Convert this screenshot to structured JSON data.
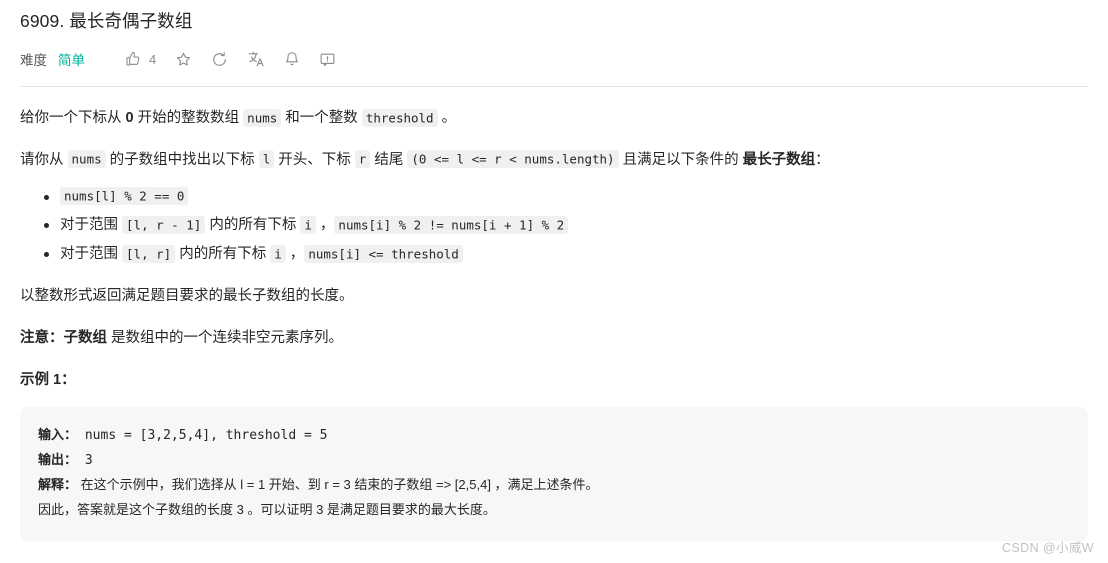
{
  "header": {
    "title": "6909. 最长奇偶子数组",
    "difficulty_label": "难度",
    "difficulty_value": "简单",
    "difficulty_color": "#00af9b",
    "like_count": "4",
    "icons": [
      "thumbs-up-icon",
      "star-icon",
      "share-icon",
      "translate-icon",
      "bell-icon",
      "comment-icon"
    ]
  },
  "content": {
    "para1": {
      "t1": "给你一个下标从 ",
      "b1": "0",
      "t2": " 开始的整数数组 ",
      "c1": "nums",
      "t3": " 和一个整数 ",
      "c2": "threshold",
      "t4": " 。"
    },
    "para2": {
      "t1": "请你从 ",
      "c1": "nums",
      "t2": " 的子数组中找出以下标 ",
      "c2": "l",
      "t3": " 开头、下标 ",
      "c3": "r",
      "t4": " 结尾 ",
      "c4": "(0 <= l <= r < nums.length)",
      "t5": " 且满足以下条件的 ",
      "b1": "最长子数组",
      "t6": "："
    },
    "conditions": [
      {
        "parts": [
          {
            "type": "code",
            "text": "nums[l] % 2 == 0"
          }
        ]
      },
      {
        "parts": [
          {
            "type": "text",
            "text": "对于范围 "
          },
          {
            "type": "code",
            "text": "[l, r - 1]"
          },
          {
            "type": "text",
            "text": " 内的所有下标 "
          },
          {
            "type": "code",
            "text": "i"
          },
          {
            "type": "text",
            "text": " ，"
          },
          {
            "type": "code",
            "text": "nums[i] % 2 != nums[i + 1] % 2"
          }
        ]
      },
      {
        "parts": [
          {
            "type": "text",
            "text": "对于范围 "
          },
          {
            "type": "code",
            "text": "[l, r]"
          },
          {
            "type": "text",
            "text": " 内的所有下标 "
          },
          {
            "type": "code",
            "text": "i"
          },
          {
            "type": "text",
            "text": " ，"
          },
          {
            "type": "code",
            "text": "nums[i] <= threshold"
          }
        ]
      }
    ],
    "para3": "以整数形式返回满足题目要求的最长子数组的长度。",
    "note": {
      "bold1": "注意：",
      "bold2": "子数组",
      "rest": " 是数组中的一个连续非空元素序列。"
    }
  },
  "example": {
    "heading": "示例 1：",
    "input_label": "输入：",
    "input_value": " nums = [3,2,5,4], threshold = 5",
    "output_label": "输出：",
    "output_value": " 3",
    "explain_label": "解释：",
    "explain_line1": " 在这个示例中，我们选择从 l = 1 开始、到 r = 3 结束的子数组 => [2,5,4] ，满足上述条件。",
    "explain_line2": "因此，答案就是这个子数组的长度 3 。可以证明 3 是满足题目要求的最大长度。"
  },
  "watermark": "CSDN @小威W"
}
